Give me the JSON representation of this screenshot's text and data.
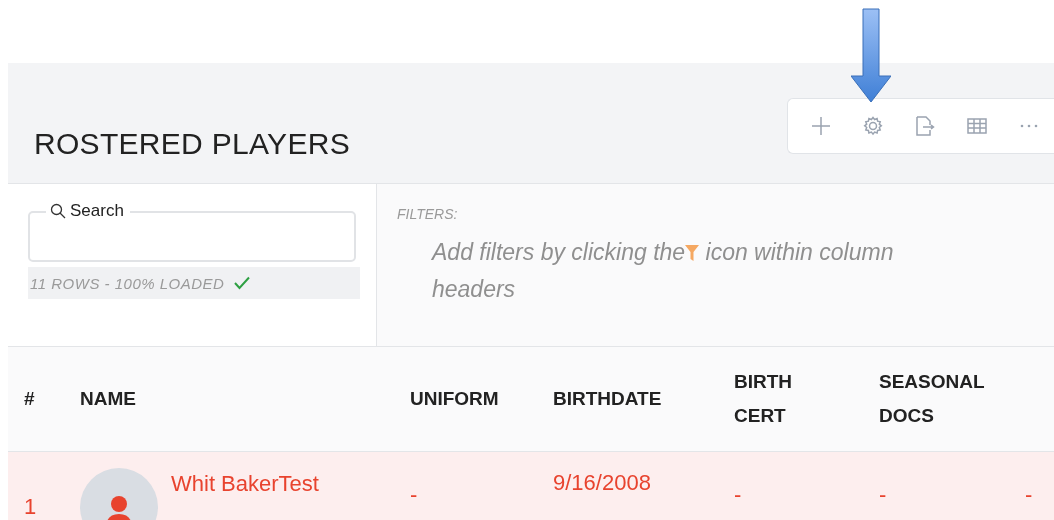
{
  "page": {
    "title": "ROSTERED PLAYERS"
  },
  "toolbar": {
    "buttons": [
      {
        "kind": "add"
      },
      {
        "kind": "settings"
      },
      {
        "kind": "export"
      },
      {
        "kind": "table"
      },
      {
        "kind": "more"
      }
    ]
  },
  "search": {
    "label": "Search",
    "status": "11 ROWS - 100% LOADED",
    "loaded": true
  },
  "filters": {
    "label": "FILTERS:",
    "hint_before": "Add filters by clicking the",
    "hint_after": "icon within column headers"
  },
  "table": {
    "columns": [
      "#",
      "NAME",
      "UNIFORM",
      "BIRTHDATE",
      "BIRTH CERT",
      "SEASONAL DOCS"
    ],
    "rows": [
      {
        "number": "1",
        "name": "Whit BakerTest",
        "uniform": "-",
        "birthdate": "9/16/2008",
        "birth_cert": "-",
        "seasonal_docs": "-",
        "column_7": "-",
        "flagged": true
      }
    ]
  }
}
